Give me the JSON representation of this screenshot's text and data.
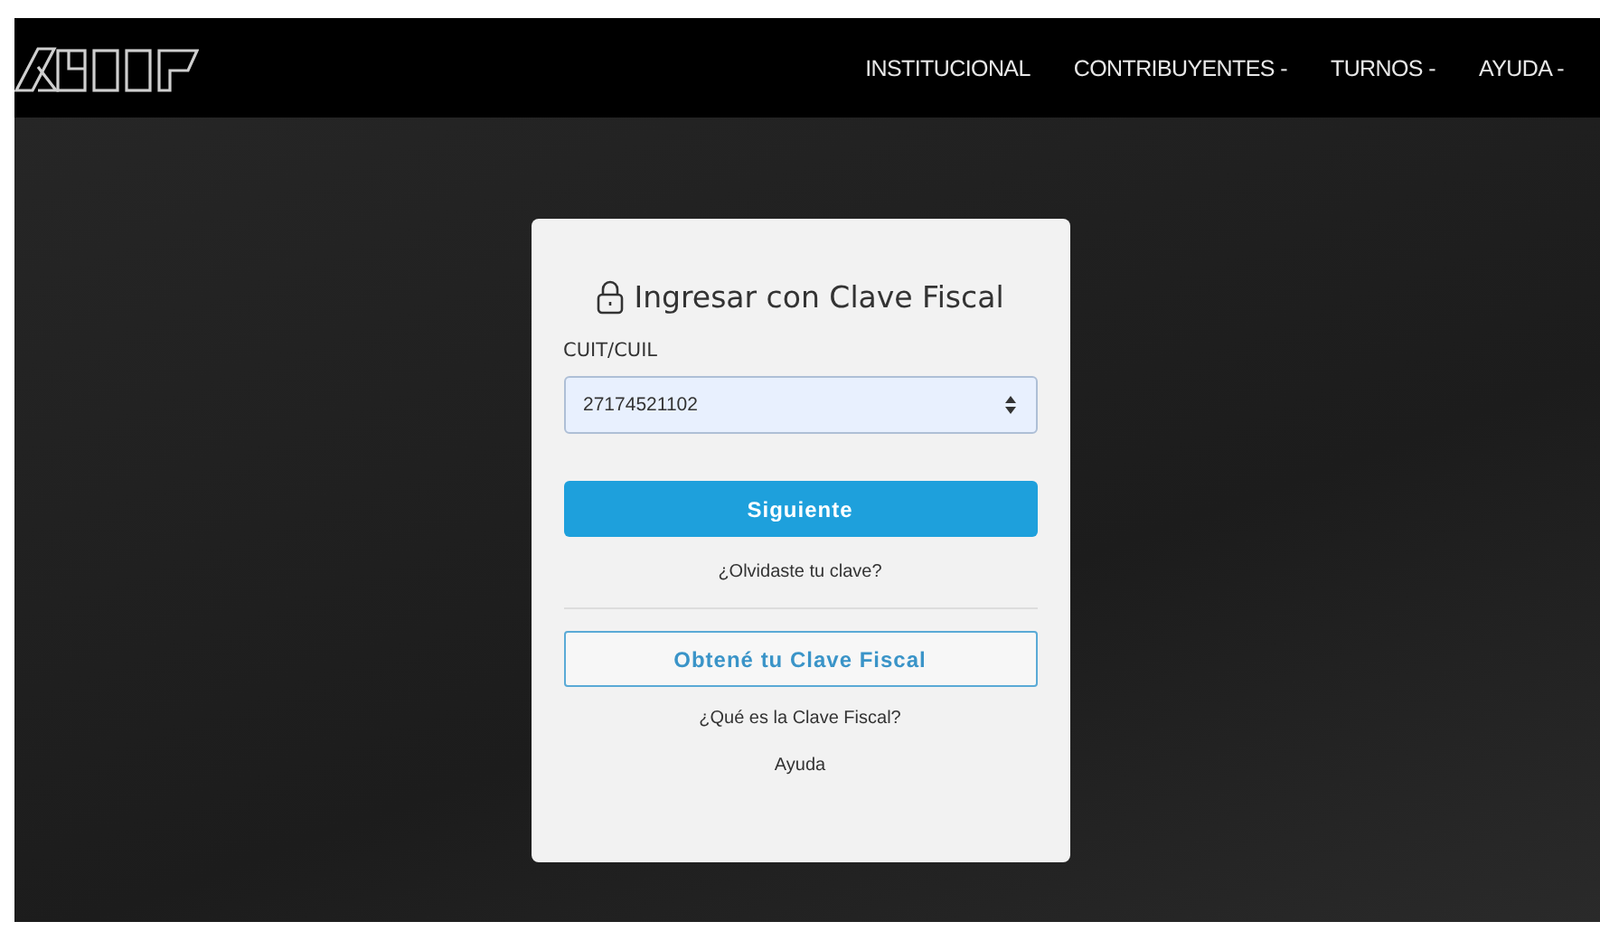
{
  "nav": [
    {
      "label": "INSTITUCIONAL"
    },
    {
      "label": "CONTRIBUYENTES -"
    },
    {
      "label": "TURNOS -"
    },
    {
      "label": "AYUDA -"
    }
  ],
  "login": {
    "title": "Ingresar con Clave Fiscal",
    "field_label": "CUIT/CUIL",
    "field_value": "27174521102",
    "submit": "Siguiente",
    "forgot_link": "¿Olvidaste tu clave?",
    "get_button": "Obtené tu Clave Fiscal",
    "what_link": "¿Qué es la Clave Fiscal?",
    "help_link": "Ayuda"
  }
}
